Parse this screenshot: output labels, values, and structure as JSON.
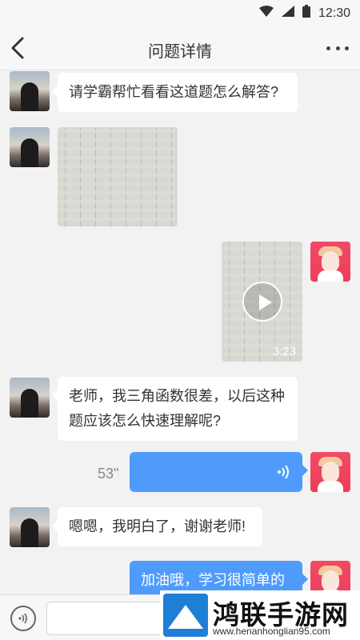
{
  "status_bar": {
    "time": "12:30"
  },
  "header": {
    "title": "问题详情"
  },
  "messages": [
    {
      "side": "left",
      "type": "text",
      "text": "请学霸帮忙看看这道题怎么解答?"
    },
    {
      "side": "left",
      "type": "image"
    },
    {
      "side": "right",
      "type": "video",
      "duration": "3:23"
    },
    {
      "side": "left",
      "type": "text",
      "lines": [
        "老师，我三角函数很差，以后这种",
        "题应该怎么快速理解呢?"
      ]
    },
    {
      "side": "right",
      "type": "voice",
      "duration": "53\""
    },
    {
      "side": "left",
      "type": "text",
      "text": "嗯嗯，我明白了，谢谢老师!"
    },
    {
      "side": "right",
      "type": "text",
      "text": "加油哦，学习很简单的~"
    }
  ],
  "input_bar": {
    "placeholder": ""
  },
  "watermark": {
    "title": "鸿联手游网",
    "url": "www.henanhonglian95.com"
  },
  "colors": {
    "accent": "#4f9bfb",
    "background": "#f2f2f2"
  }
}
